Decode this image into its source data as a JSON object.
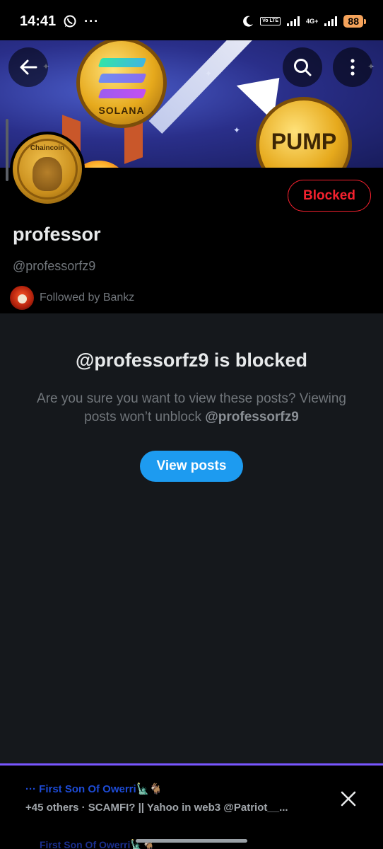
{
  "status_bar": {
    "time": "14:41",
    "dots": "···",
    "volte": "Vo LTE",
    "network": "4G+",
    "battery": "88"
  },
  "banner": {
    "solana_label": "SOLANA",
    "pump_label": "PUMP"
  },
  "profile": {
    "avatar_text": "Chaincoin",
    "blocked_label": "Blocked",
    "display_name": "professor",
    "handle": "@professorfz9",
    "followed_by": "Followed by Bankz"
  },
  "notice": {
    "title": "@professorfz9 is blocked",
    "body_prefix": "Are you sure you want to view these posts? Viewing posts won’t unblock ",
    "body_handle": "@professorfz9",
    "button_label": "View posts"
  },
  "notification": {
    "line1": "··· First Son Of Owerri🗽🐐",
    "line2": "+45 others · SCAMFI? || Yahoo in web3 @Patriot__...",
    "ghost": "First Son Of Owerri🗽🐐"
  },
  "icons": {
    "back": "arrow-left-icon",
    "search": "search-icon",
    "more": "more-vertical-icon",
    "close": "close-icon"
  },
  "colors": {
    "accent_blue": "#1d9bf0",
    "blocked_red": "#f4212e",
    "progress_purple": "#7856ff",
    "battery_orange": "#f5a35b"
  }
}
